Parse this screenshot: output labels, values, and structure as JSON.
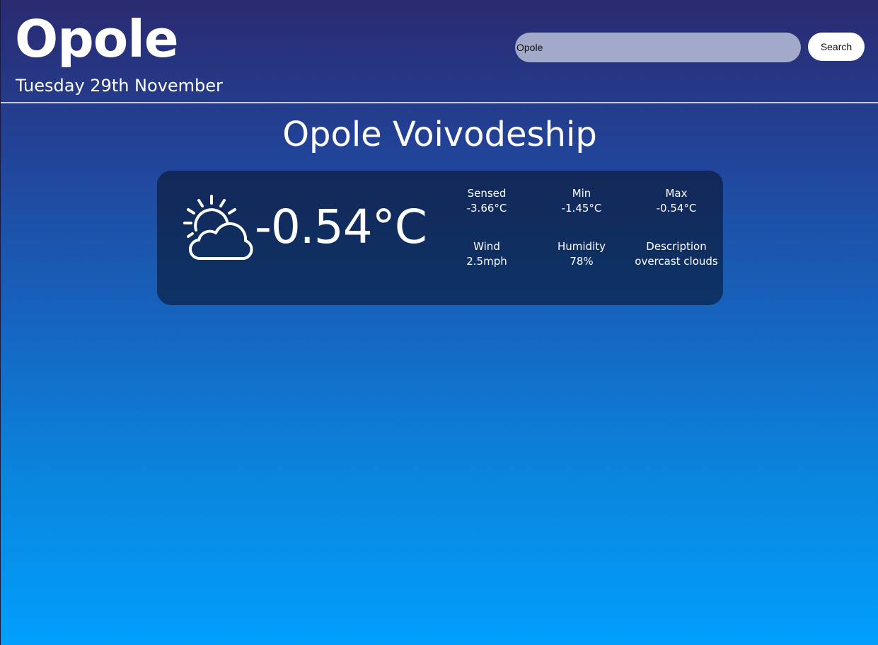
{
  "header": {
    "city": "Opole",
    "date": "Tuesday 29th November"
  },
  "search": {
    "value": "Opole",
    "placeholder": "",
    "button_label": "Search"
  },
  "region": "Opole Voivodeship",
  "weather": {
    "icon": "partly-cloudy-icon",
    "temperature": "-0.54°C",
    "stats": {
      "sensed": {
        "label": "Sensed",
        "value": "-3.66°C"
      },
      "min": {
        "label": "Min",
        "value": "-1.45°C"
      },
      "max": {
        "label": "Max",
        "value": "-0.54°C"
      },
      "wind": {
        "label": "Wind",
        "value": "2.5mph"
      },
      "humidity": {
        "label": "Humidity",
        "value": "78%"
      },
      "description": {
        "label": "Description",
        "value": "overcast clouds"
      }
    }
  },
  "colors": {
    "background_top": "#2a2a70",
    "background_bottom": "#019ffd",
    "card": "#132858",
    "search_input": "#a3a9c9"
  }
}
